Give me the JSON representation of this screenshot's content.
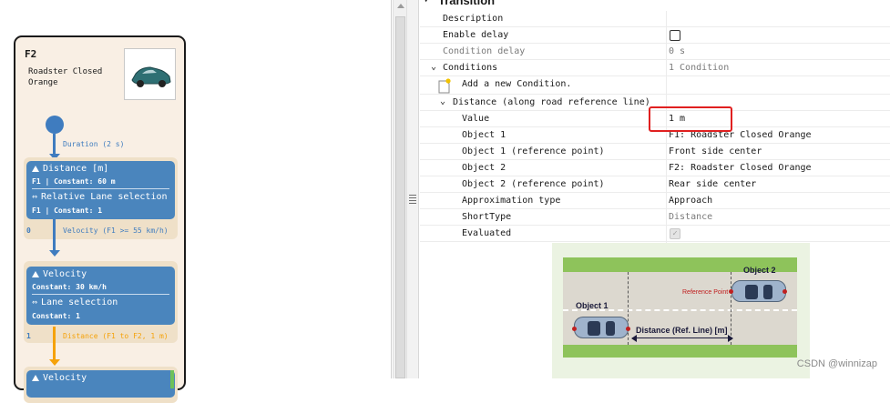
{
  "storyboard": {
    "entity_title": "F2",
    "entity_subtitle": "Roadster Closed Orange",
    "transitions": [
      {
        "label": "Duration (2 s)",
        "number": ""
      },
      {
        "label": "Velocity (F1 >= 55 km/h)",
        "number": "0"
      },
      {
        "label": "Distance (F1 to F2, 1 m)",
        "number": "1"
      }
    ],
    "states": [
      {
        "head1": "Distance [m]",
        "sub1": "F1 | Constant: 60 m",
        "head2": "Relative Lane selection",
        "sub2": "F1 | Constant: 1"
      },
      {
        "head1": "Velocity",
        "sub1": "Constant: 30 km/h",
        "head2": "Lane selection",
        "sub2": "Constant: 1"
      },
      {
        "head1": "Velocity"
      }
    ],
    "colors": {
      "state_blue": "#4a85bd",
      "highlight_arrow": "#f5a20a",
      "card_bg": "#f9efe4"
    }
  },
  "properties": {
    "section_title": "Transition",
    "rows": [
      {
        "name": "Description",
        "value": ""
      },
      {
        "name": "Enable delay",
        "value": ""
      },
      {
        "name": "Condition delay",
        "value": "0 s"
      },
      {
        "name": "Conditions",
        "value": "1 Condition"
      },
      {
        "name": "Add a new Condition.",
        "value": ""
      },
      {
        "name": "Distance (along road reference line)",
        "value": ""
      },
      {
        "name": "Value",
        "value": "1 m"
      },
      {
        "name": "Object 1",
        "value": "F1: Roadster Closed Orange"
      },
      {
        "name": "Object 1 (reference point)",
        "value": "Front side center"
      },
      {
        "name": "Object 2",
        "value": "F2: Roadster Closed Orange"
      },
      {
        "name": "Object 2 (reference point)",
        "value": "Rear side center"
      },
      {
        "name": "Approximation type",
        "value": "Approach"
      },
      {
        "name": "ShortType",
        "value": "Distance"
      },
      {
        "name": "Evaluated",
        "value": ""
      }
    ],
    "enable_delay_checked": false,
    "evaluated_checked": true
  },
  "diagram": {
    "object1_label": "Object 1",
    "object2_label": "Object 2",
    "reference_point_label": "Reference Point",
    "distance_label": "Distance (Ref. Line) [m]"
  },
  "watermark": "CSDN @winnizap"
}
